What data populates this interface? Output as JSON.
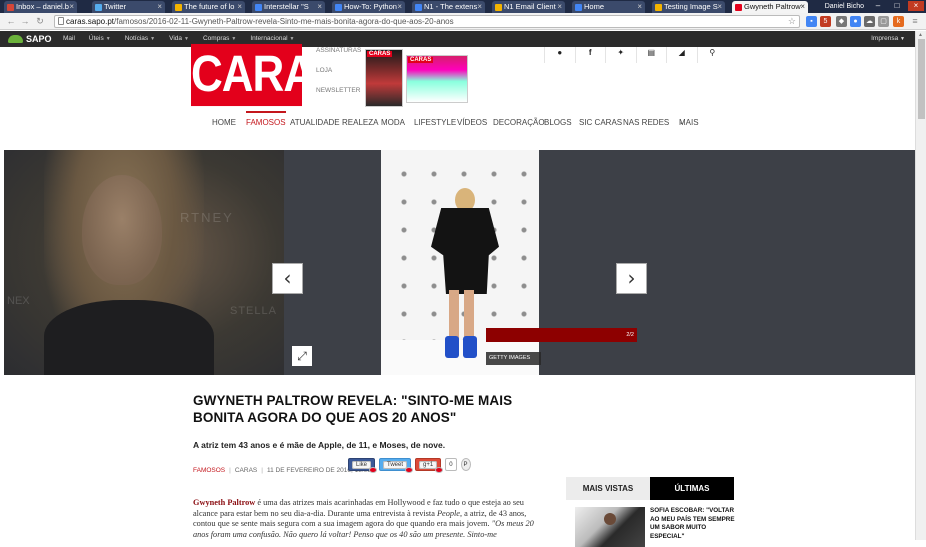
{
  "browser": {
    "tabs": [
      {
        "label": "Inbox – daniel.b",
        "color": "#d44638"
      },
      {
        "label": "Twitter",
        "color": "#55acee"
      },
      {
        "label": "The future of lo",
        "color": "#f4b400"
      },
      {
        "label": "Interstellar \"S",
        "color": "#4285f4"
      },
      {
        "label": "How-To: Python",
        "color": "#4285f4"
      },
      {
        "label": "N1 - The extens",
        "color": "#4285f4"
      },
      {
        "label": "N1 Email Client",
        "color": "#f4b400"
      },
      {
        "label": "Home",
        "color": "#4285f4"
      },
      {
        "label": "Testing Image S",
        "color": "#f4b400"
      },
      {
        "label": "Gwyneth Paltrow",
        "color": "#e3001b",
        "active": true
      }
    ],
    "profile": "Daniel Bicho",
    "url_host": "caras.sapo.pt",
    "url_path": "/famosos/2016-02-11-Gwyneth-Paltrow-revela-Sinto-me-mais-bonita-agora-do-que-aos-20-anos",
    "ext_badge": "5"
  },
  "sapo": {
    "logo": "SAPO",
    "links": [
      "Mail",
      "Úteis",
      "Notícias",
      "Vida",
      "Compras",
      "Internacional"
    ],
    "right": "Imprensa"
  },
  "site": {
    "logo": "CARAS",
    "header_links": [
      "ASSINATURAS",
      "LOJA",
      "NEWSLETTER"
    ],
    "magazine_tags": [
      "CARAS",
      "CARAS"
    ],
    "util_icons": [
      "user-icon",
      "facebook-icon",
      "twitter-icon",
      "newsletter-icon",
      "rss-icon",
      "search-icon"
    ],
    "nav": [
      "HOME",
      "FAMOSOS",
      "ATUALIDADE",
      "REALEZA",
      "MODA",
      "LIFESTYLE",
      "VÍDEOS",
      "DECORAÇÃO",
      "BLOGS",
      "SIC CARAS",
      "NAS REDES",
      "MAIS"
    ],
    "active_nav": "FAMOSOS"
  },
  "gallery": {
    "counter": "2/2",
    "credit": "GETTY IMAGES",
    "watermarks": [
      "RTNEY",
      "NEX",
      "STELLA"
    ]
  },
  "article": {
    "title": "GWYNETH PALTROW REVELA: \"SINTO-ME MAIS BONITA AGORA DO QUE AOS 20 ANOS\"",
    "lead": "A atriz tem 43 anos e é mãe de Apple, de 11, e Moses, de nove.",
    "category": "FAMOSOS",
    "source": "CARAS",
    "date": "11 DE FEVEREIRO DE 2016, 18:09",
    "share": {
      "like": "Like",
      "tweet": "Tweet",
      "gplus": "g+1",
      "count": "0"
    },
    "body_name": "Gwyneth Paltrow",
    "body_1": " é uma das atrizes mais acarinhadas em Hollywood e faz tudo o que esteja ao seu alcance para estar bem no seu dia-a-dia. Durante uma entrevista à revista ",
    "body_mag": "People",
    "body_2": ", a atriz, de 43 anos, contou que se sente mais segura com a sua imagem agora do que quando era mais jovem. ",
    "body_quote": "\"Os meus 20 anos foram uma confusão. Não quero lá voltar! Penso que os 40 são um presente. Sinto-me"
  },
  "sidebar": {
    "tabs": [
      "MAIS VISTAS",
      "ÚLTIMAS"
    ],
    "item_title": "SOFIA ESCOBAR: \"VOLTAR AO MEU PAÍS TEM SEMPRE UM SABOR MUITO ESPECIAL\""
  }
}
